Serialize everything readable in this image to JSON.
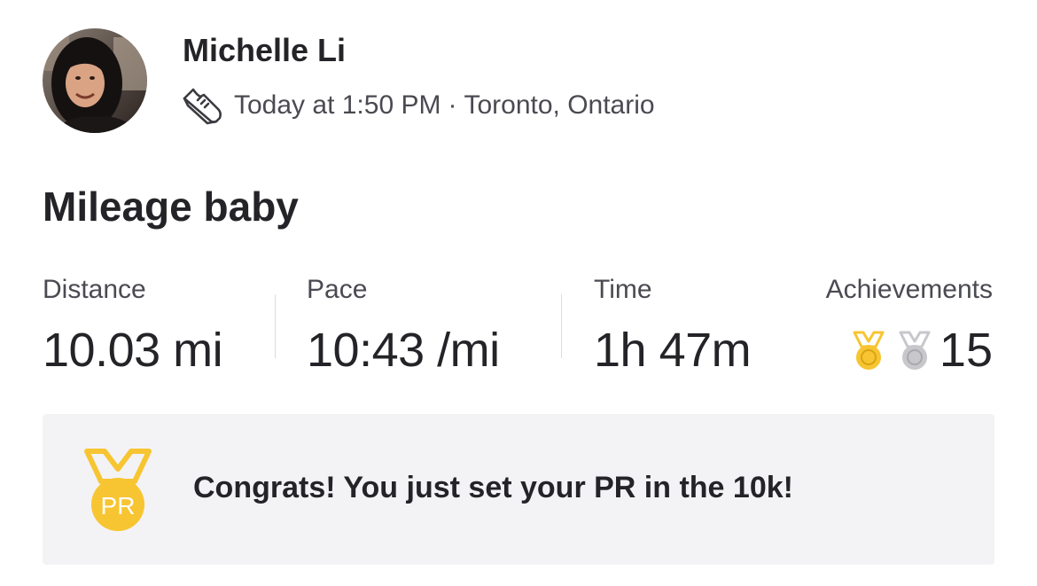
{
  "header": {
    "athlete_name": "Michelle Li",
    "activity_icon": "running-shoe-icon",
    "timestamp": "Today at 1:50 PM",
    "separator": "·",
    "location": "Toronto, Ontario"
  },
  "activity": {
    "title": "Mileage baby"
  },
  "stats": {
    "distance": {
      "label": "Distance",
      "value": "10.03 mi"
    },
    "pace": {
      "label": "Pace",
      "value": "10:43 /mi"
    },
    "time": {
      "label": "Time",
      "value": "1h 47m"
    },
    "achievements": {
      "label": "Achievements",
      "count": "15",
      "medals": [
        "gold-medal-icon",
        "silver-medal-icon"
      ]
    }
  },
  "pr_banner": {
    "icon": "pr-medal-icon",
    "icon_text": "PR",
    "message": "Congrats! You just set your PR in the 10k!"
  },
  "colors": {
    "text_primary": "#242428",
    "text_secondary": "#4a4a52",
    "gold": "#f7c531",
    "silver": "#c7c7cc",
    "banner_bg": "#f3f3f5",
    "divider": "#dcdce0"
  }
}
